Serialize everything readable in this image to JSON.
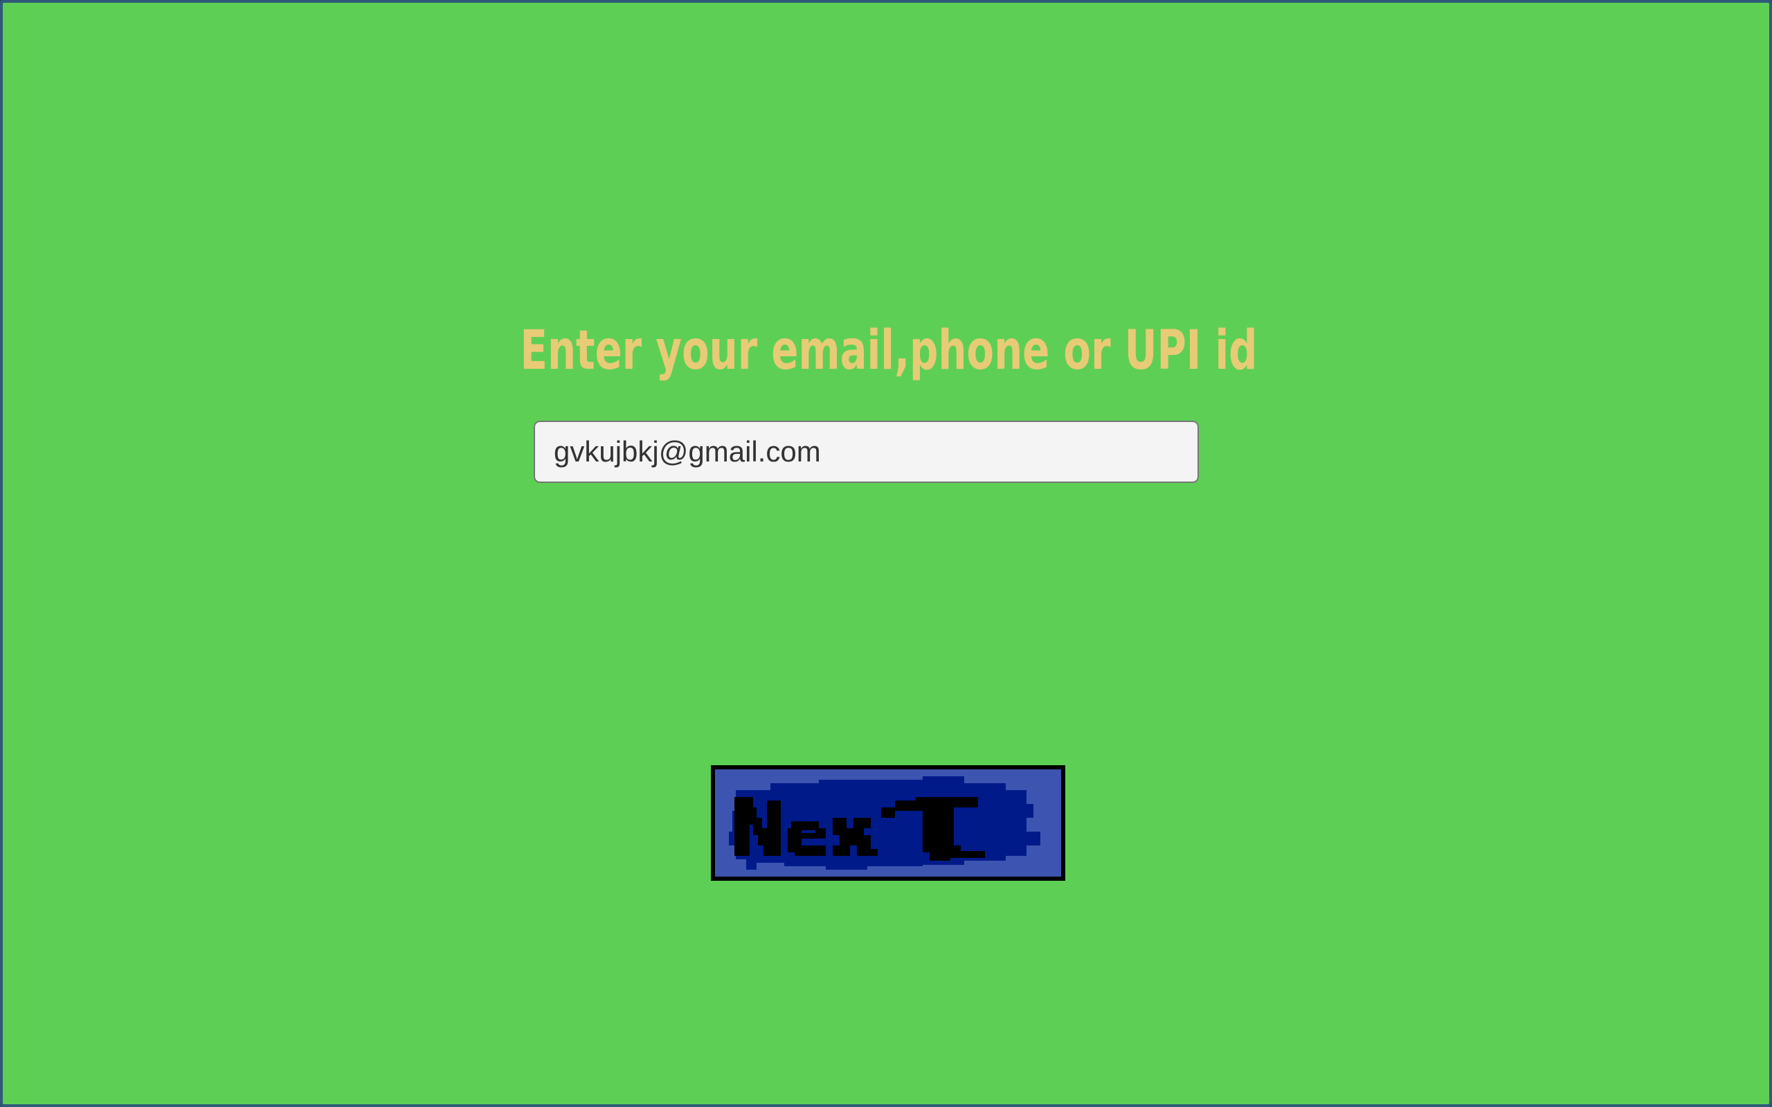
{
  "page": {
    "heading": "Enter your email,phone or UPI id",
    "input": {
      "value": "gvkujbkj@gmail.com",
      "placeholder": ""
    },
    "next_button": {
      "label": "Next",
      "icon": "pixel-art-next-label"
    }
  },
  "colors": {
    "background": "#5ecf55",
    "heading": "#e8cb76",
    "button_fill": "#3d55b0",
    "button_ink": "#000000",
    "button_blob": "#001a8a"
  }
}
